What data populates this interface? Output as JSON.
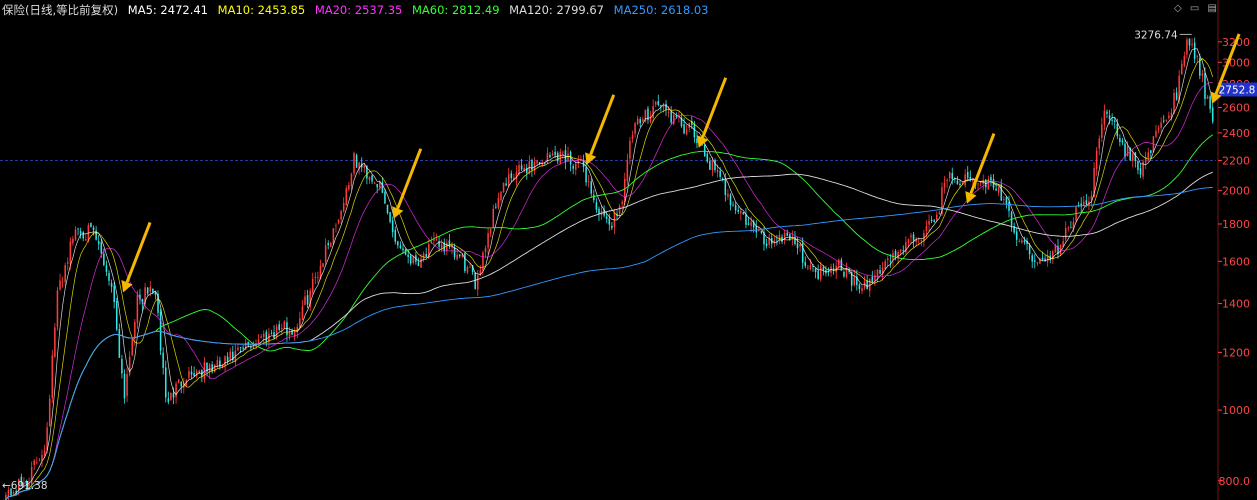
{
  "header": {
    "title": "保险(日线,等比前复权)",
    "ma_indicators": [
      {
        "label": "MA5: 2472.41",
        "color": "#ffffff"
      },
      {
        "label": "MA10: 2453.85",
        "color": "#ffff00"
      },
      {
        "label": "MA20: 2537.35",
        "color": "#ff33ff"
      },
      {
        "label": "MA60: 2812.49",
        "color": "#33ff33"
      },
      {
        "label": "MA120: 2799.67",
        "color": "#dddddd"
      },
      {
        "label": "MA250: 2618.03",
        "color": "#3399ff"
      }
    ],
    "icons": [
      "diamond-icon",
      "chart-toggle-icon",
      "menu-icon"
    ]
  },
  "colors": {
    "background": "#000000",
    "up": "#ff3b3b",
    "down": "#33e6e6",
    "axis_text": "#ff4444",
    "arrow": "#f5b800",
    "dashed_line": "#2a3a9a"
  },
  "chart_data": {
    "type": "candlestick",
    "y_axis": {
      "scale": "log",
      "range": [
        760,
        3450
      ],
      "ticks": [
        800,
        1000,
        1200,
        1400,
        1600,
        1800,
        2000,
        2200,
        2400,
        2600,
        2800,
        3000,
        3200
      ],
      "tick_labels": [
        "800.0",
        "1000",
        "1200",
        "1400",
        "1600",
        "1800",
        "2000",
        "2200",
        "2400",
        "2600",
        "2800",
        "3000",
        "3200"
      ]
    },
    "max_label": "3276.74",
    "min_label": "691.38",
    "current_price_label": "2752.8",
    "current_price": 2752.8,
    "reference_line": 2200,
    "price_path_anchors": [
      [
        0,
        760
      ],
      [
        0.02,
        800
      ],
      [
        0.035,
        900
      ],
      [
        0.045,
        1450
      ],
      [
        0.06,
        1780
      ],
      [
        0.075,
        1740
      ],
      [
        0.09,
        1480
      ],
      [
        0.1,
        1050
      ],
      [
        0.11,
        1400
      ],
      [
        0.125,
        1480
      ],
      [
        0.135,
        1020
      ],
      [
        0.15,
        1120
      ],
      [
        0.18,
        1150
      ],
      [
        0.21,
        1250
      ],
      [
        0.23,
        1300
      ],
      [
        0.24,
        1280
      ],
      [
        0.26,
        1550
      ],
      [
        0.28,
        1900
      ],
      [
        0.29,
        2200
      ],
      [
        0.31,
        2050
      ],
      [
        0.325,
        1700
      ],
      [
        0.34,
        1600
      ],
      [
        0.36,
        1700
      ],
      [
        0.38,
        1600
      ],
      [
        0.39,
        1490
      ],
      [
        0.41,
        2000
      ],
      [
        0.43,
        2150
      ],
      [
        0.46,
        2250
      ],
      [
        0.48,
        2150
      ],
      [
        0.49,
        1900
      ],
      [
        0.5,
        1780
      ],
      [
        0.51,
        1900
      ],
      [
        0.52,
        2400
      ],
      [
        0.54,
        2650
      ],
      [
        0.555,
        2500
      ],
      [
        0.57,
        2400
      ],
      [
        0.59,
        2100
      ],
      [
        0.61,
        1850
      ],
      [
        0.63,
        1700
      ],
      [
        0.65,
        1750
      ],
      [
        0.67,
        1540
      ],
      [
        0.69,
        1600
      ],
      [
        0.71,
        1450
      ],
      [
        0.73,
        1600
      ],
      [
        0.75,
        1700
      ],
      [
        0.77,
        1800
      ],
      [
        0.78,
        2100
      ],
      [
        0.8,
        2050
      ],
      [
        0.82,
        2050
      ],
      [
        0.84,
        1700
      ],
      [
        0.86,
        1580
      ],
      [
        0.875,
        1700
      ],
      [
        0.89,
        1900
      ],
      [
        0.9,
        2000
      ],
      [
        0.91,
        2650
      ],
      [
        0.925,
        2300
      ],
      [
        0.94,
        2150
      ],
      [
        0.955,
        2400
      ],
      [
        0.97,
        2700
      ],
      [
        0.98,
        3250
      ],
      [
        0.99,
        2900
      ],
      [
        1.0,
        2450
      ]
    ],
    "annotations": [
      {
        "type": "arrow",
        "tip": [
          0.1012,
          1450
        ]
      },
      {
        "type": "arrow",
        "tip": [
          0.3238,
          1830
        ]
      },
      {
        "type": "arrow",
        "tip": [
          0.4825,
          2170
        ]
      },
      {
        "type": "arrow",
        "tip": [
          0.5746,
          2290
        ]
      },
      {
        "type": "arrow",
        "tip": [
          0.7952,
          1920
        ]
      },
      {
        "type": "arrow",
        "tip": [
          0.9968,
          2630
        ]
      }
    ],
    "moving_averages": [
      "MA5",
      "MA10",
      "MA20",
      "MA60",
      "MA120",
      "MA250"
    ]
  }
}
